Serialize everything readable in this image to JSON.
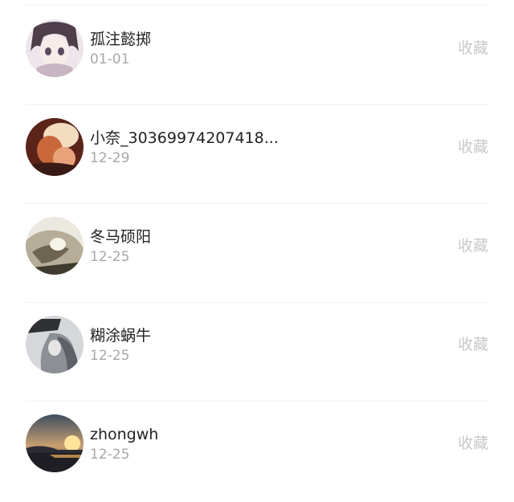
{
  "users": [
    {
      "name": "孤注懿掷",
      "date": "01-01",
      "action": "收藏",
      "avatar_colors": [
        "#e9e3ea",
        "#5b4a55",
        "#c9b9c4"
      ]
    },
    {
      "name": "小奈_30369974207418...",
      "date": "12-29",
      "action": "收藏",
      "avatar_colors": [
        "#6b2a1e",
        "#c86a3a",
        "#f0d2b0"
      ]
    },
    {
      "name": "冬马硕阳",
      "date": "12-25",
      "action": "收藏",
      "avatar_colors": [
        "#e8e6de",
        "#8a806c",
        "#4a4638"
      ]
    },
    {
      "name": "糊涂蜗牛",
      "date": "12-25",
      "action": "收藏",
      "avatar_colors": [
        "#d8dadd",
        "#8d9298",
        "#3a3c40"
      ]
    },
    {
      "name": "zhongwh",
      "date": "12-25",
      "action": "收藏",
      "avatar_colors": [
        "#4a5a6a",
        "#f2b64a",
        "#1e1e24"
      ]
    }
  ]
}
